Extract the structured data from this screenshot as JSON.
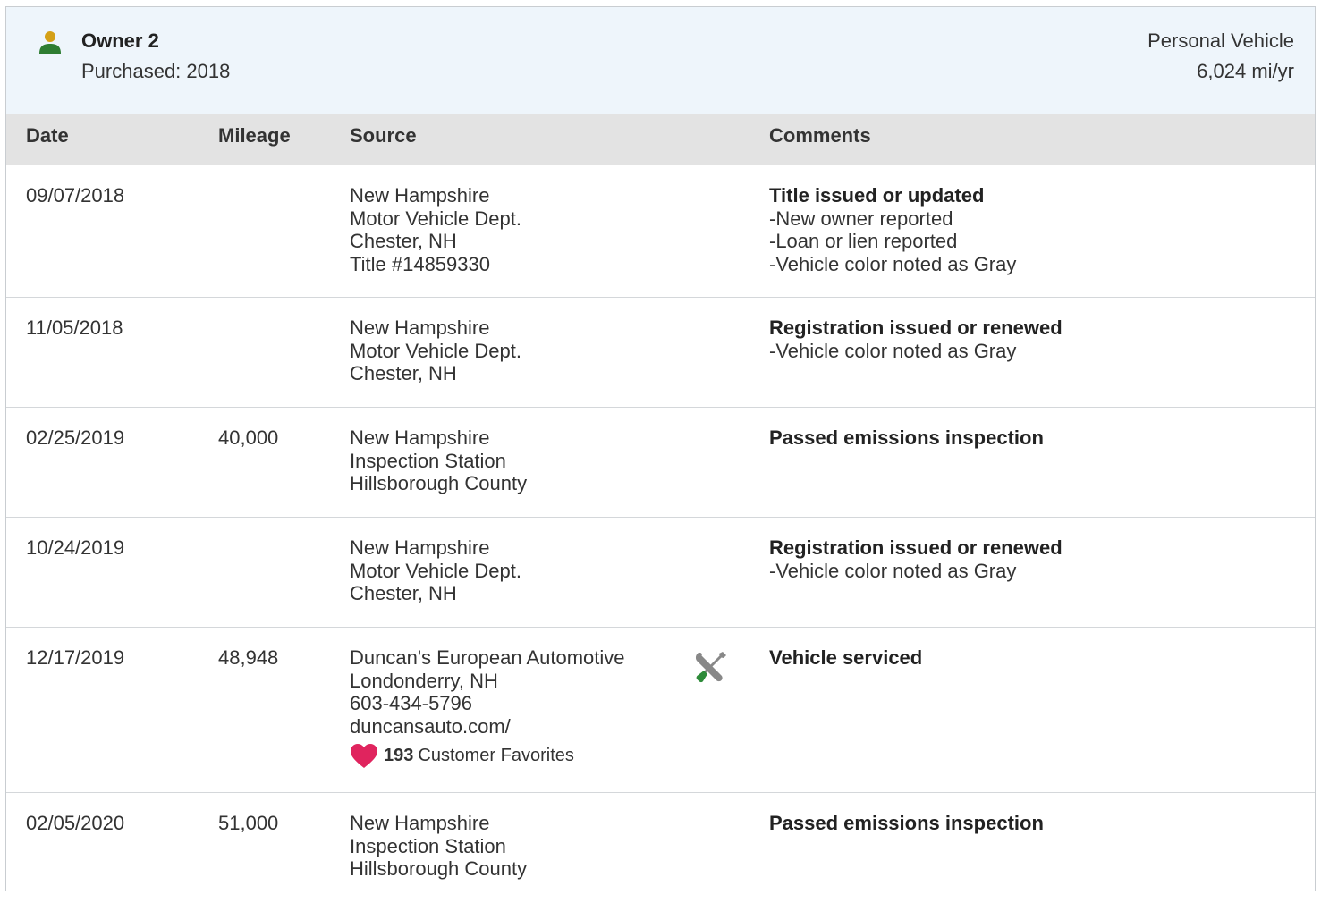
{
  "owner": {
    "name": "Owner 2",
    "purchased": "Purchased: 2018",
    "vehicle_type": "Personal Vehicle",
    "miles_per_year": "6,024 mi/yr"
  },
  "columns": {
    "date": "Date",
    "mileage": "Mileage",
    "source": "Source",
    "comments": "Comments"
  },
  "rows": [
    {
      "date": "09/07/2018",
      "mileage": "",
      "source": [
        "New Hampshire",
        "Motor Vehicle Dept.",
        "Chester, NH",
        "Title #14859330"
      ],
      "comment_title": "Title issued or updated",
      "comment_lines": [
        "-New owner reported",
        "-Loan or lien reported",
        "-Vehicle color noted as Gray"
      ]
    },
    {
      "date": "11/05/2018",
      "mileage": "",
      "source": [
        "New Hampshire",
        "Motor Vehicle Dept.",
        "Chester, NH"
      ],
      "comment_title": "Registration issued or renewed",
      "comment_lines": [
        "-Vehicle color noted as Gray"
      ]
    },
    {
      "date": "02/25/2019",
      "mileage": "40,000",
      "source": [
        "New Hampshire",
        "Inspection Station",
        "Hillsborough County"
      ],
      "comment_title": "Passed emissions inspection",
      "comment_lines": []
    },
    {
      "date": "10/24/2019",
      "mileage": "",
      "source": [
        "New Hampshire",
        "Motor Vehicle Dept.",
        "Chester, NH"
      ],
      "comment_title": "Registration issued or renewed",
      "comment_lines": [
        "-Vehicle color noted as Gray"
      ]
    },
    {
      "date": "12/17/2019",
      "mileage": "48,948",
      "source": [
        "Duncan's European Automotive",
        "Londonderry, NH",
        "603-434-5796",
        "duncansauto.com/"
      ],
      "favorites_count": "193",
      "favorites_label": "Customer Favorites",
      "service_icon": "wrench-screwdriver-icon",
      "comment_title": "Vehicle serviced",
      "comment_lines": []
    },
    {
      "date": "02/05/2020",
      "mileage": "51,000",
      "source": [
        "New Hampshire",
        "Inspection Station",
        "Hillsborough County"
      ],
      "comment_title": "Passed emissions inspection",
      "comment_lines": []
    }
  ],
  "colors": {
    "header_bg": "#eef5fb",
    "column_header_bg": "#e3e3e3",
    "owner_icon_head": "#d4a017",
    "owner_icon_body": "#2e7d32",
    "heart": "#e0245e",
    "tool_gray": "#888888",
    "tool_green": "#2e8b3a"
  }
}
